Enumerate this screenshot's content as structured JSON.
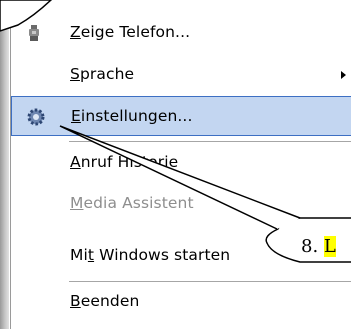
{
  "menu": {
    "items": [
      {
        "id": "show-phone",
        "mnemonic": "Z",
        "rest": "eige Telefon...",
        "icon": "phone-icon"
      },
      {
        "id": "language",
        "mnemonic": "S",
        "rest": "prache",
        "submenu": true
      },
      {
        "id": "settings",
        "mnemonic": "E",
        "rest": "instellungen...",
        "icon": "gear-icon",
        "selected": true
      },
      {
        "id": "call-history",
        "mnemonic": "A",
        "rest": "nruf Historie"
      },
      {
        "id": "media-assistant",
        "mnemonic": "M",
        "rest": "edia Assistent",
        "disabled": true
      },
      {
        "id": "start-with-windows",
        "prefix": "Mi",
        "mnemonic": "t",
        "rest": " Windows starten"
      },
      {
        "id": "exit",
        "mnemonic": "B",
        "rest": "eenden"
      }
    ]
  },
  "callout": {
    "number": "8. ",
    "highlight": "L",
    "highlight_color": "#ffff00"
  },
  "colors": {
    "selection_bg": "#c3d6f1",
    "selection_border": "#3d6fc3",
    "disabled_text": "#8e8e8e"
  }
}
